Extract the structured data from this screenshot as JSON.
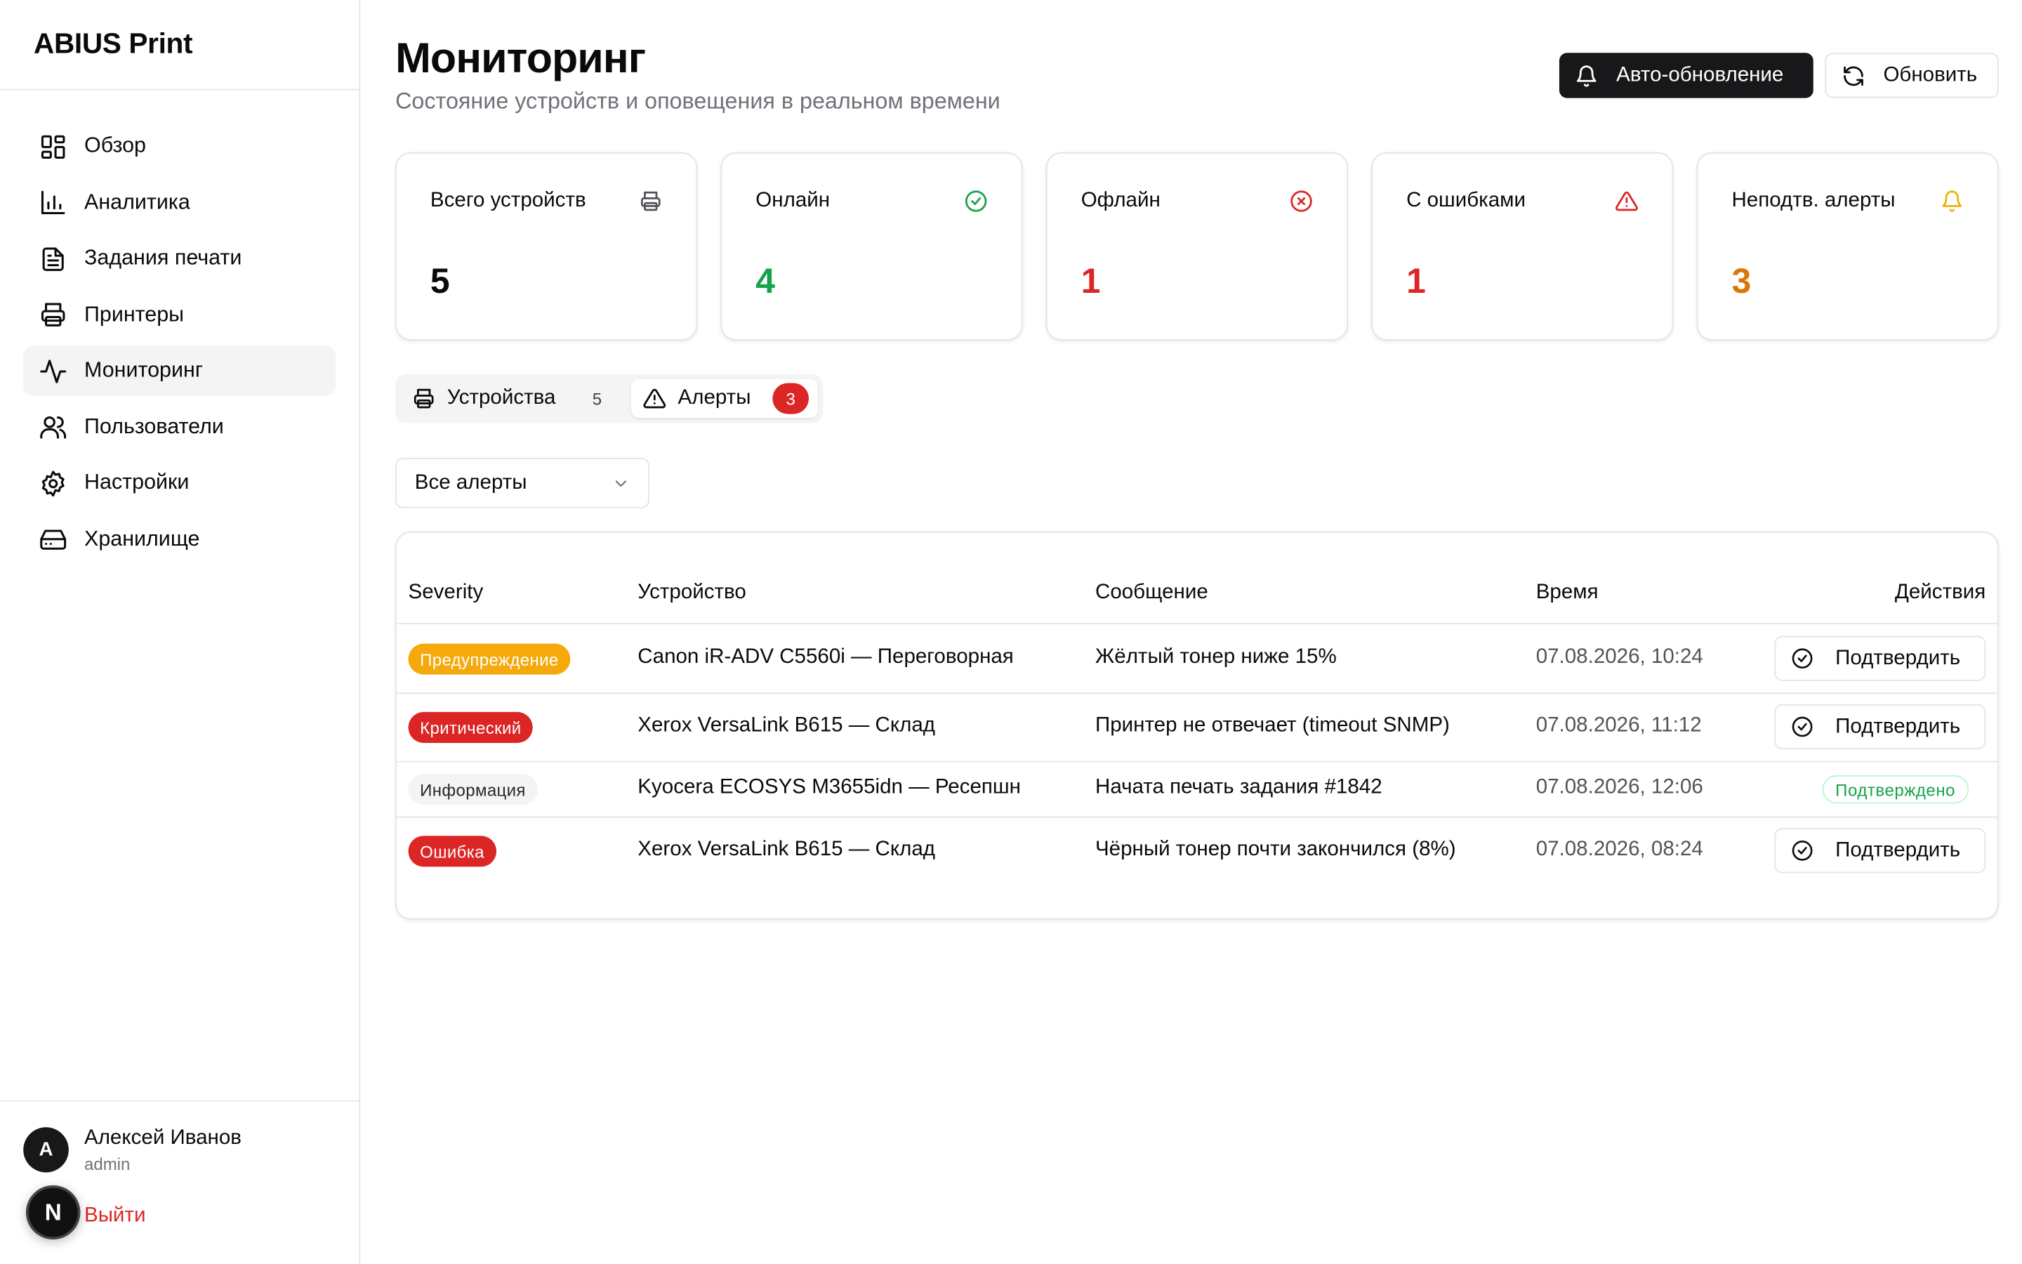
{
  "sidebar": {
    "brand": "ABIUS Print",
    "items": [
      {
        "label": "Обзор",
        "icon": "dashboard-icon"
      },
      {
        "label": "Аналитика",
        "icon": "bar-chart-icon"
      },
      {
        "label": "Задания печати",
        "icon": "document-icon"
      },
      {
        "label": "Принтеры",
        "icon": "printer-icon"
      },
      {
        "label": "Мониторинг",
        "icon": "activity-icon",
        "active": true
      },
      {
        "label": "Пользователи",
        "icon": "users-icon"
      },
      {
        "label": "Настройки",
        "icon": "gear-icon"
      },
      {
        "label": "Хранилище",
        "icon": "hard-drive-icon"
      }
    ],
    "user": {
      "initial": "A",
      "name": "Алексей Иванов",
      "role": "admin"
    },
    "logout": "Выйти",
    "dev_badge": "N"
  },
  "header": {
    "title": "Мониторинг",
    "subtitle": "Состояние устройств и оповещения в реальном времени",
    "auto_refresh_label": "Авто-обновление",
    "refresh_label": "Обновить"
  },
  "stats": [
    {
      "title": "Всего устройств",
      "value": "5",
      "color": "#0a0a0a",
      "icon": "printer-icon"
    },
    {
      "title": "Онлайн",
      "value": "4",
      "color": "#16a34a",
      "icon": "check-circle-icon"
    },
    {
      "title": "Офлайн",
      "value": "1",
      "color": "#dc2626",
      "icon": "x-circle-icon"
    },
    {
      "title": "С ошибками",
      "value": "1",
      "color": "#dc2626",
      "icon": "warning-triangle-icon"
    },
    {
      "title": "Неподтв. алерты",
      "value": "3",
      "color": "#d97706",
      "icon": "bell-icon"
    }
  ],
  "tabs": {
    "devices": {
      "label": "Устройства",
      "count": "5"
    },
    "alerts": {
      "label": "Алерты",
      "count": "3"
    }
  },
  "filter": {
    "selected": "Все алерты"
  },
  "table": {
    "headers": {
      "severity": "Severity",
      "device": "Устройство",
      "message": "Сообщение",
      "time": "Время",
      "actions": "Действия"
    },
    "rows": [
      {
        "severity": "Предупреждение",
        "device": "Canon iR-ADV C5560i — Переговорная",
        "message": "Жёлтый тонер ниже 15%",
        "time": "07.08.2026, 10:24",
        "action": "Подтвердить"
      },
      {
        "severity": "Критический",
        "device": "Xerox VersaLink B615 — Склад",
        "message": "Принтер не отвечает (timeout SNMP)",
        "time": "07.08.2026, 11:12",
        "action": "Подтвердить"
      },
      {
        "severity": "Информация",
        "device": "Kyocera ECOSYS M3655idn — Ресепшн",
        "message": "Начата печать задания #1842",
        "time": "07.08.2026, 12:06",
        "action": "Подтверждено"
      },
      {
        "severity": "Ошибка",
        "device": "Xerox VersaLink B615 — Склад",
        "message": "Чёрный тонер почти закончился (8%)",
        "time": "07.08.2026, 08:24",
        "action": "Подтвердить"
      }
    ]
  }
}
